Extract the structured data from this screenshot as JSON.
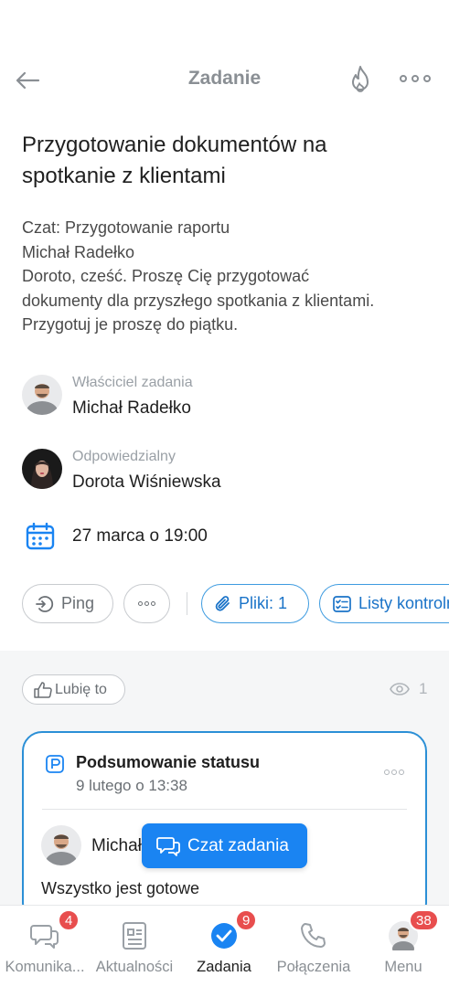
{
  "header": {
    "title": "Zadanie"
  },
  "task": {
    "title": "Przygotowanie dokumentów na spotkanie z klientami",
    "description_lines": [
      "Czat: Przygotowanie raportu",
      "Michał Radełko",
      "Doroto, cześć. Proszę Cię przygotować",
      "dokumenty dla przyszłego spotkania z klientami.",
      "Przygotuj je proszę do piątku."
    ],
    "owner": {
      "role": "Właściciel zadania",
      "name": "Michał Radełko"
    },
    "responsible": {
      "role": "Odpowiedzialny",
      "name": "Dorota Wiśniewska"
    },
    "deadline": "27 marca o 19:00"
  },
  "actions": {
    "ping": "Ping",
    "files": "Pliki: 1",
    "lists": "Listy kontrolne"
  },
  "feed": {
    "like": "Lubię to",
    "views": "1",
    "status_card": {
      "title": "Podsumowanie statusu",
      "time": "9 lutego o 13:38",
      "author": "Michał Radełko",
      "message": "Wszystko jest gotowe"
    }
  },
  "chat_button": "Czat zadania",
  "tabbar": {
    "items": [
      {
        "label": "Komunika...",
        "badge": "4"
      },
      {
        "label": "Aktualności"
      },
      {
        "label": "Zadania",
        "badge": "9"
      },
      {
        "label": "Połączenia"
      },
      {
        "label": "Menu",
        "badge": "38"
      }
    ]
  },
  "colors": {
    "accent": "#1a84f2",
    "badge": "#e84e4e",
    "card_border": "#2b8fd6"
  }
}
